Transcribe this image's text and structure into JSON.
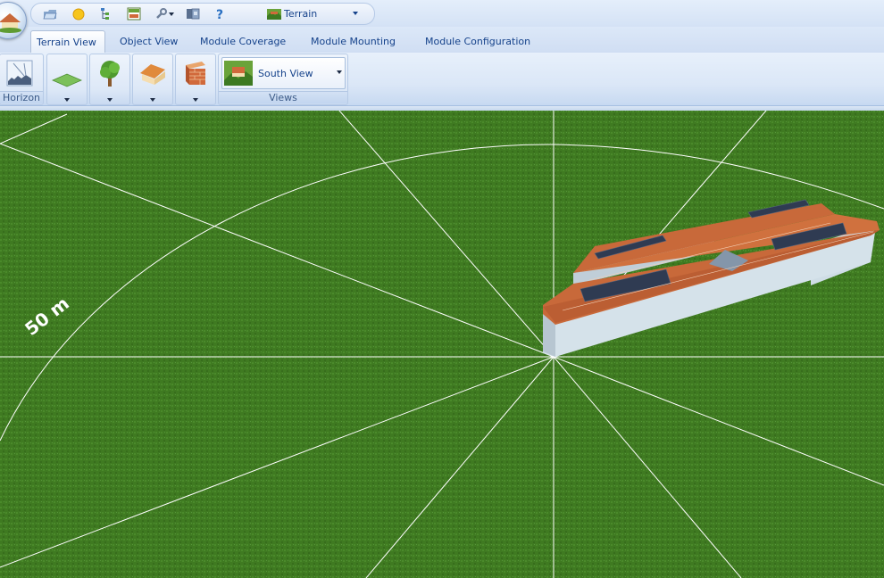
{
  "quick_access": {
    "terrain_selector": "Terrain"
  },
  "tabs": [
    {
      "label": "Terrain View",
      "active": true
    },
    {
      "label": "Object View",
      "active": false
    },
    {
      "label": "Module Coverage",
      "active": false
    },
    {
      "label": "Module Mounting",
      "active": false
    },
    {
      "label": "Module Configuration",
      "active": false
    }
  ],
  "ribbon": {
    "horizon_group": "Horizon",
    "views_group": "Views",
    "view_selector": "South View"
  },
  "viewport": {
    "scale_label": "50 m",
    "colors": {
      "grass": "#3f7a21",
      "grid_lines": "#ffffff",
      "roof": "#c8693a",
      "wall": "#cfdde6",
      "panels": "#2f3b52"
    }
  }
}
